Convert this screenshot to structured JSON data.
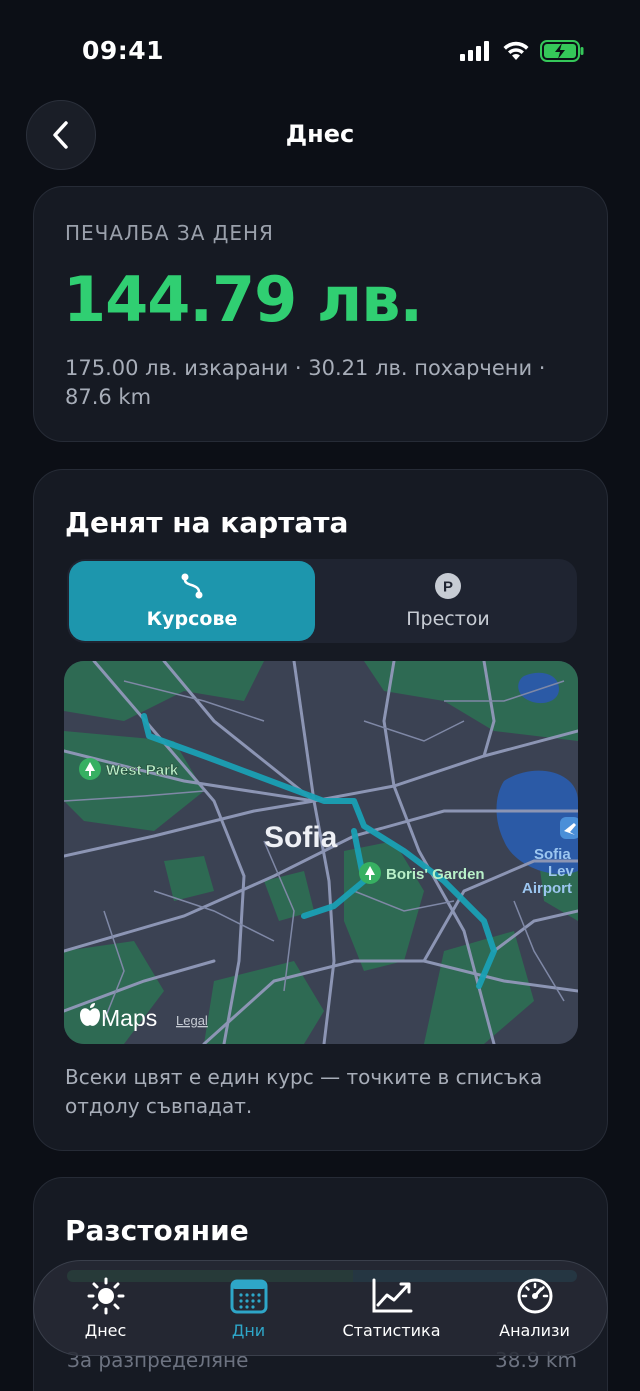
{
  "status_bar": {
    "time": "09:41"
  },
  "nav": {
    "title": "Днес"
  },
  "profit": {
    "label": "ПЕЧАЛБА ЗА ДЕНЯ",
    "value": "144.79 лв.",
    "details": "175.00 лв. изкарани · 30.21 лв. похарчени · 87.6 km"
  },
  "map_section": {
    "title": "Денят на картата",
    "segments": [
      {
        "label": "Курсове",
        "icon": "route-icon",
        "selected": true
      },
      {
        "label": "Престои",
        "icon": "parking-icon",
        "selected": false
      }
    ],
    "map": {
      "city_label": "Sofia",
      "poi": [
        "West Park",
        "Boris' Garden",
        "Sofia",
        "Lev",
        "Airport"
      ],
      "attribution": "Maps",
      "legal": "Legal"
    },
    "caption": "Всеки цвят е един курс — точките в списъка отдолу съвпадат."
  },
  "distance": {
    "title": "Разстояние",
    "row_label": "За разпределяне",
    "row_value": "38.9 km"
  },
  "tab_bar": {
    "tabs": [
      {
        "label": "Днес",
        "icon": "sun-icon",
        "active": false
      },
      {
        "label": "Дни",
        "icon": "calendar-icon",
        "active": true
      },
      {
        "label": "Статистика",
        "icon": "chart-icon",
        "active": false
      },
      {
        "label": "Анализи",
        "icon": "gauge-icon",
        "active": false
      }
    ]
  },
  "colors": {
    "profit_green": "#30cf72",
    "accent_teal": "#1d96ad",
    "route": "#1aa0b4",
    "tab_active": "#2ea6c8"
  }
}
